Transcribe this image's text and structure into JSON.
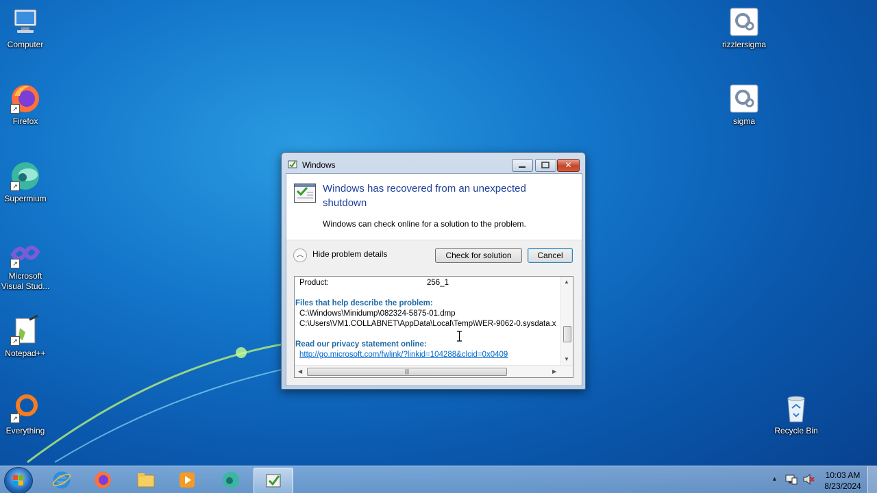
{
  "desktop": {
    "icons": [
      {
        "label": "Computer"
      },
      {
        "label": "Firefox"
      },
      {
        "label": "Supermium"
      },
      {
        "label": "Microsoft Visual Stud..."
      },
      {
        "label": "Notepad++"
      },
      {
        "label": "Everything"
      },
      {
        "label": "rizzlersigma"
      },
      {
        "label": "sigma"
      },
      {
        "label": "Recycle Bin"
      }
    ]
  },
  "dialog": {
    "title": "Windows",
    "heading": "Windows has recovered from an unexpected shutdown",
    "subtext": "Windows can check online for a solution to the problem.",
    "expander_label": "Hide problem details",
    "check_button": "Check for solution",
    "cancel_button": "Cancel",
    "details": {
      "product_label": "Product:",
      "product_value": "256_1",
      "files_heading": "Files that help describe the problem:",
      "files": [
        "C:\\Windows\\Minidump\\082324-5875-01.dmp",
        "C:\\Users\\VM1.COLLABNET\\AppData\\Local\\Temp\\WER-9062-0.sysdata.x"
      ],
      "privacy_heading": "Read our privacy statement online:",
      "privacy_link": "http://go.microsoft.com/fwlink/?linkid=104288&clcid=0x0409"
    }
  },
  "taskbar": {
    "apps": [
      "internet-explorer",
      "firefox",
      "file-explorer",
      "media-player",
      "supermium",
      "action-center"
    ],
    "clock_time": "10:03 AM",
    "clock_date": "8/23/2024"
  },
  "colors": {
    "heading": "#1e3f9a",
    "details_heading": "#1e6aa6",
    "link": "#0066cc"
  }
}
